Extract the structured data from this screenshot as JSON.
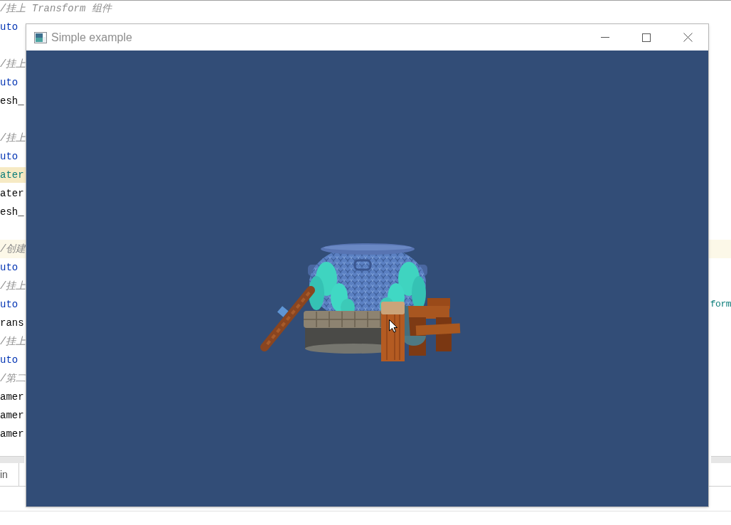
{
  "code_lines": [
    {
      "kind": "comment",
      "text": "/挂上 Transform 组件",
      "current": false,
      "highlighted": false
    },
    {
      "kind": "keyword",
      "text": "uto",
      "current": false,
      "highlighted": false
    },
    {
      "kind": "blank",
      "current": false
    },
    {
      "kind": "comment",
      "text": "/挂上",
      "current": false,
      "highlighted": false
    },
    {
      "kind": "keyword",
      "text": "uto",
      "current": false,
      "highlighted": false
    },
    {
      "kind": "identifier",
      "text": "esh_",
      "current": false,
      "highlighted": false
    },
    {
      "kind": "blank",
      "current": false
    },
    {
      "kind": "comment",
      "text": "/挂上",
      "current": false,
      "highlighted": false
    },
    {
      "kind": "keyword",
      "text": "uto",
      "current": false,
      "highlighted": false
    },
    {
      "kind": "field",
      "text": "ater",
      "current": false,
      "highlighted": true
    },
    {
      "kind": "identifier",
      "text": "ater",
      "current": false,
      "highlighted": false
    },
    {
      "kind": "identifier",
      "text": "esh_",
      "current": false,
      "highlighted": false
    },
    {
      "kind": "blank",
      "current": false
    },
    {
      "kind": "comment",
      "text": "/创建",
      "current": true,
      "highlighted": false
    },
    {
      "kind": "keyword",
      "text": "uto",
      "current": false,
      "highlighted": false
    },
    {
      "kind": "comment",
      "text": "/挂上",
      "current": false,
      "highlighted": false
    },
    {
      "kind": "keyword",
      "text": "uto",
      "current": false,
      "highlighted": false,
      "right": {
        "kind": "type",
        "text": "form"
      }
    },
    {
      "kind": "identifier",
      "text": "rans",
      "current": false,
      "highlighted": false
    },
    {
      "kind": "comment",
      "text": "/挂上",
      "current": false,
      "highlighted": false
    },
    {
      "kind": "keyword",
      "text": "uto",
      "current": false,
      "highlighted": false
    },
    {
      "kind": "comment",
      "text": "/第二",
      "current": false,
      "highlighted": false
    },
    {
      "kind": "identifier",
      "text": "amer",
      "current": false,
      "highlighted": false
    },
    {
      "kind": "identifier",
      "text": "amer",
      "current": false,
      "highlighted": false
    },
    {
      "kind": "identifier",
      "text": "amer",
      "current": false,
      "highlighted": false
    }
  ],
  "bottom_panel": {
    "tabs": [
      {
        "label": "in"
      }
    ]
  },
  "window": {
    "title": "Simple example"
  }
}
